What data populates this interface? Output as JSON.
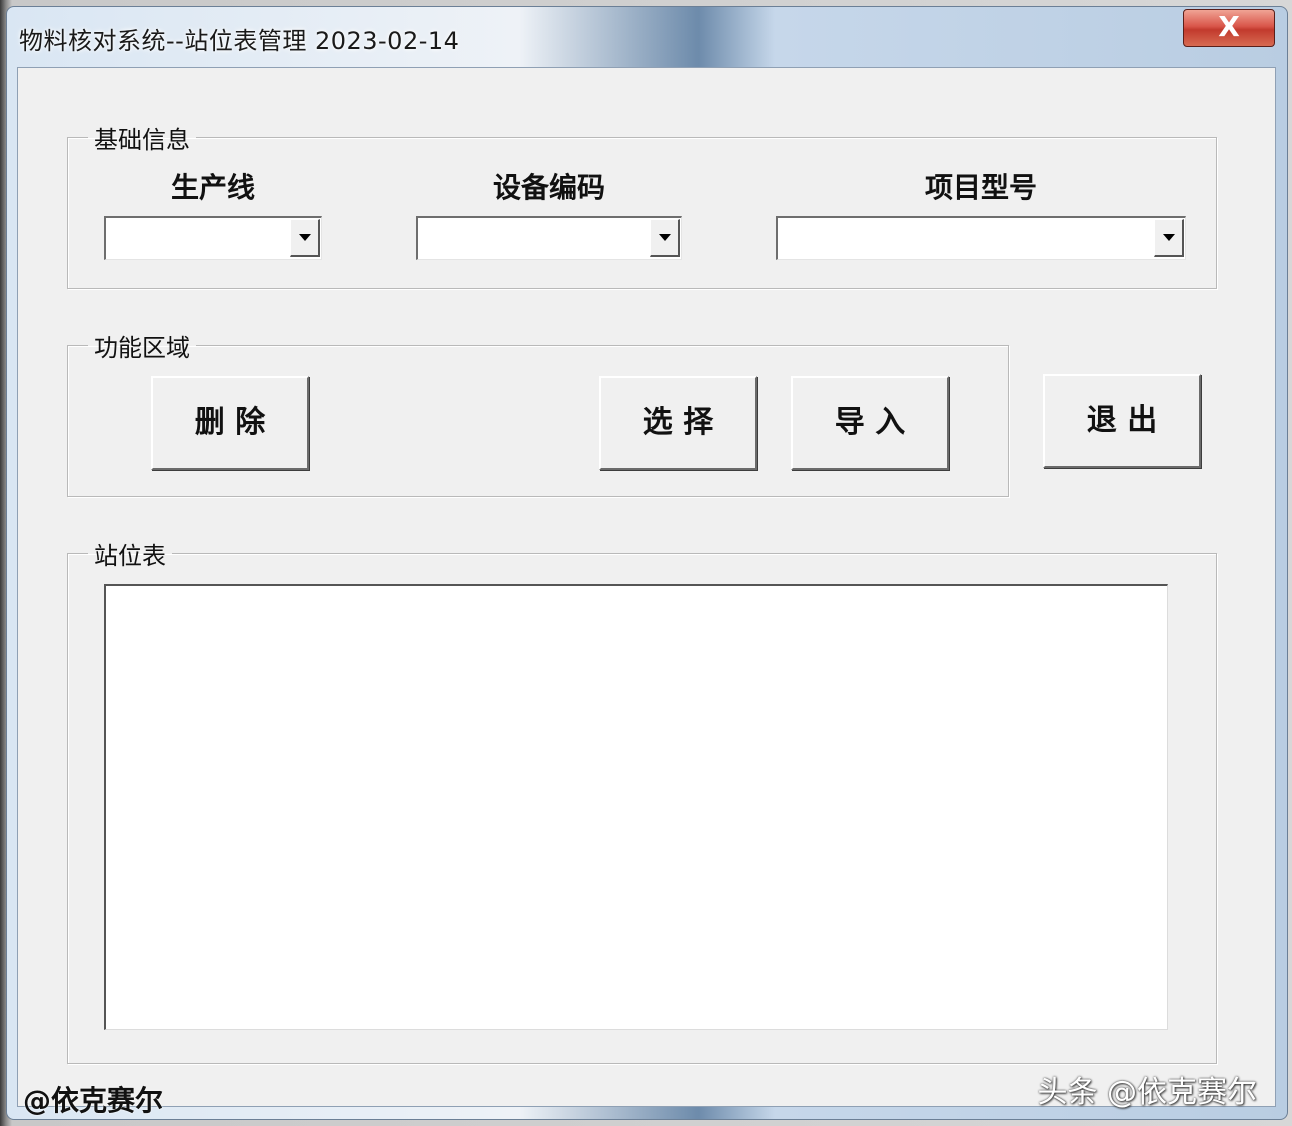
{
  "window": {
    "title": "物料核对系统--站位表管理 2023-02-14",
    "close_label": "X"
  },
  "basic_info": {
    "legend": "基础信息",
    "fields": [
      {
        "label": "生产线",
        "value": ""
      },
      {
        "label": "设备编码",
        "value": ""
      },
      {
        "label": "项目型号",
        "value": ""
      }
    ]
  },
  "function_area": {
    "legend": "功能区域",
    "delete_label": "删 除",
    "select_label": "选 择",
    "import_label": "导 入"
  },
  "exit_label": "退 出",
  "station_table": {
    "legend": "站位表"
  },
  "watermarks": {
    "left": "@依克赛尔",
    "right": "头条 @依克赛尔"
  }
}
